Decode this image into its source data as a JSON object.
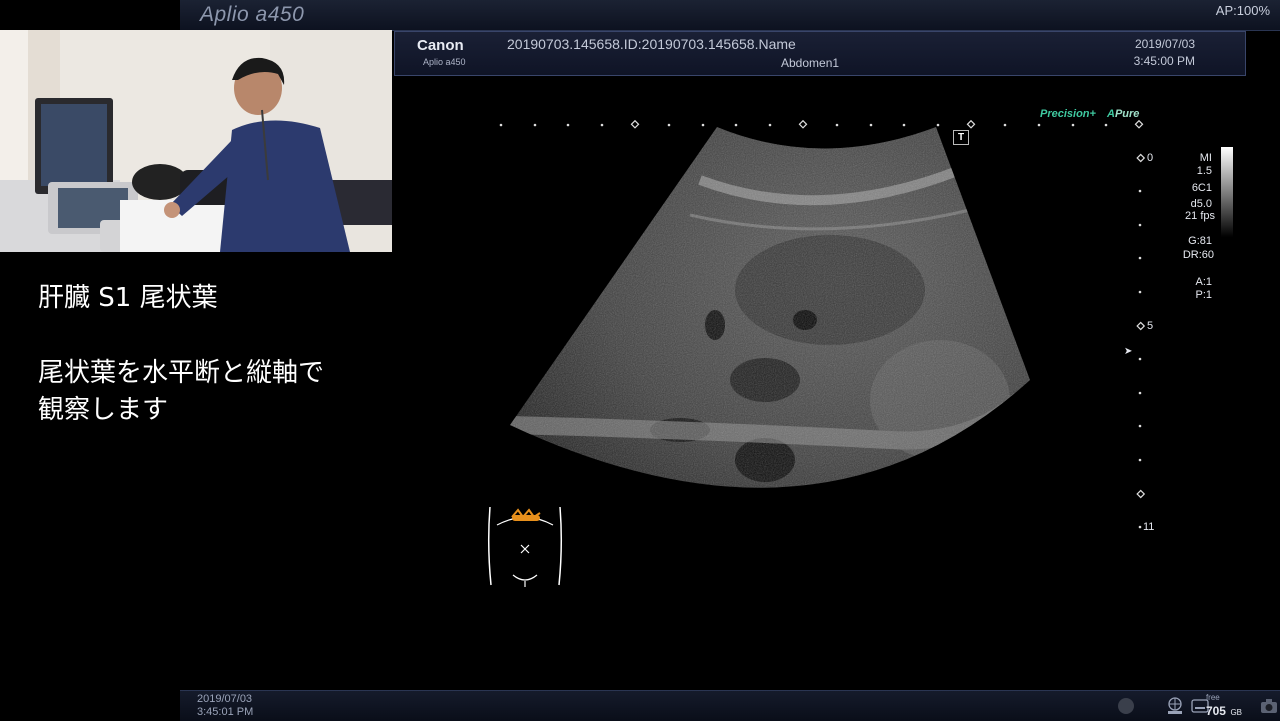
{
  "top_bar": {
    "brand": "Aplio a450",
    "acoustic_power": "AP:100%"
  },
  "caption": {
    "line1": "肝臓 S1 尾状葉",
    "line2": "尾状葉を水平断と縦軸で",
    "line3": "観察します"
  },
  "info_bar": {
    "logo": "Canon",
    "logo_sub": "Aplio a450",
    "patient_id": "20190703.145658.ID:20190703.145658.Name",
    "preset": "Abdomen1",
    "date": "2019/07/03",
    "time": "3:45:00 PM"
  },
  "image_tags": {
    "precision": "Precision+",
    "apure": "Pure",
    "apure_prefix": "A",
    "t_marker": "T"
  },
  "parameters": {
    "mi_label": "MI",
    "mi_value": "1.5",
    "probe": "6C1",
    "depth": "d5.0",
    "fps": "21 fps",
    "gain": "G:81",
    "dynamic_range": "DR:60",
    "a": "A:1",
    "p": "P:1"
  },
  "depth_scale": {
    "d0": "0",
    "d5": "5",
    "d11": "11",
    "focus_marker": "➤"
  },
  "status_bar": {
    "date": "2019/07/03",
    "time": "3:45:01 PM",
    "free_label": "free",
    "free_value": "705",
    "free_unit": "GB"
  }
}
